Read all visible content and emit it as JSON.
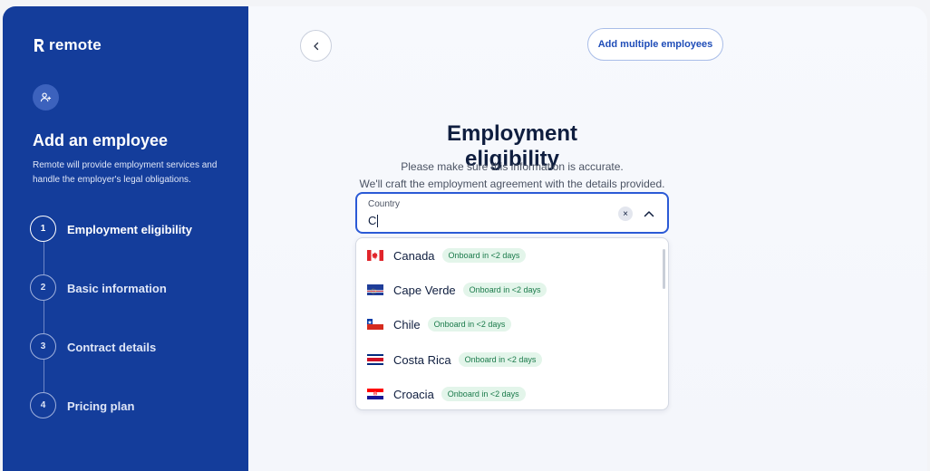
{
  "brand": {
    "name": "remote"
  },
  "sidebar": {
    "title": "Add an employee",
    "description": "Remote will provide employment services and handle the employer's legal obligations.",
    "steps": [
      {
        "number": "1",
        "label": "Employment eligibility",
        "active": true
      },
      {
        "number": "2",
        "label": "Basic information",
        "active": false
      },
      {
        "number": "3",
        "label": "Contract details",
        "active": false
      },
      {
        "number": "4",
        "label": "Pricing plan",
        "active": false
      }
    ]
  },
  "header": {
    "add_multiple_label": "Add multiple employees"
  },
  "main": {
    "title": "Employment eligibility",
    "subtitle_line1": "Please make sure this information is accurate.",
    "subtitle_line2": "We'll craft the employment agreement with the details provided."
  },
  "country_field": {
    "label": "Country",
    "value": "C",
    "clear_glyph": "×"
  },
  "country_options": [
    {
      "name": "Canada",
      "badge": "Onboard in <2 days",
      "flag": "canada-flag-icon"
    },
    {
      "name": "Cape Verde",
      "badge": "Onboard in <2 days",
      "flag": "cape-verde-flag-icon"
    },
    {
      "name": "Chile",
      "badge": "Onboard in <2 days",
      "flag": "chile-flag-icon"
    },
    {
      "name": "Costa Rica",
      "badge": "Onboard in <2 days",
      "flag": "costa-rica-flag-icon"
    },
    {
      "name": "Croacia",
      "badge": "Onboard in <2 days",
      "flag": "croatia-flag-icon"
    }
  ],
  "colors": {
    "sidebar_bg": "#143d9b",
    "accent": "#2b5ad6",
    "badge_bg": "#e3f5ea",
    "badge_text": "#1a7a4a"
  }
}
